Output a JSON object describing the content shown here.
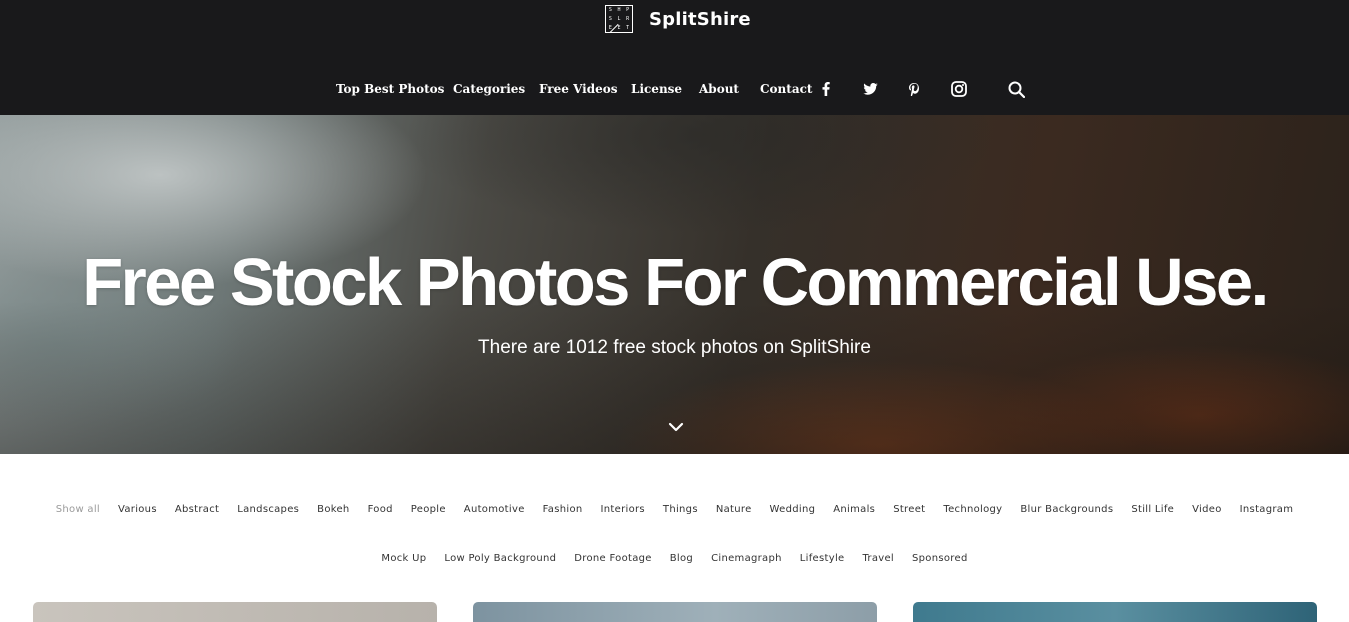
{
  "brand": {
    "logo_letters": [
      "S",
      "H",
      "P",
      "S",
      "L",
      "R",
      "E",
      "E",
      "T"
    ],
    "name": "SplitShire"
  },
  "nav": {
    "items": [
      "Top Best Photos",
      "Categories",
      "Free Videos",
      "License",
      "About",
      "Contact"
    ],
    "icons": [
      "facebook-icon",
      "twitter-icon",
      "pinterest-icon",
      "instagram-icon",
      "search-icon"
    ]
  },
  "hero": {
    "title": "Free Stock Photos For Commercial Use.",
    "subtitle": "There are 1012 free stock photos on SplitShire",
    "scroll_icon": "chevron-down-icon"
  },
  "filters": {
    "row1": [
      "Show all",
      "Various",
      "Abstract",
      "Landscapes",
      "Bokeh",
      "Food",
      "People",
      "Automotive",
      "Fashion",
      "Interiors",
      "Things",
      "Nature",
      "Wedding",
      "Animals",
      "Street",
      "Technology",
      "Blur Backgrounds",
      "Still Life",
      "Video",
      "Instagram"
    ],
    "row2": [
      "Mock Up",
      "Low Poly Background",
      "Drone Footage",
      "Blog",
      "Cinemagraph",
      "Lifestyle",
      "Travel",
      "Sponsored"
    ],
    "active": "Show all"
  },
  "colors": {
    "header_bg": "#19191b",
    "text_light": "#ffffff",
    "filter_text": "#333333",
    "filter_active": "#9a9a9a"
  }
}
